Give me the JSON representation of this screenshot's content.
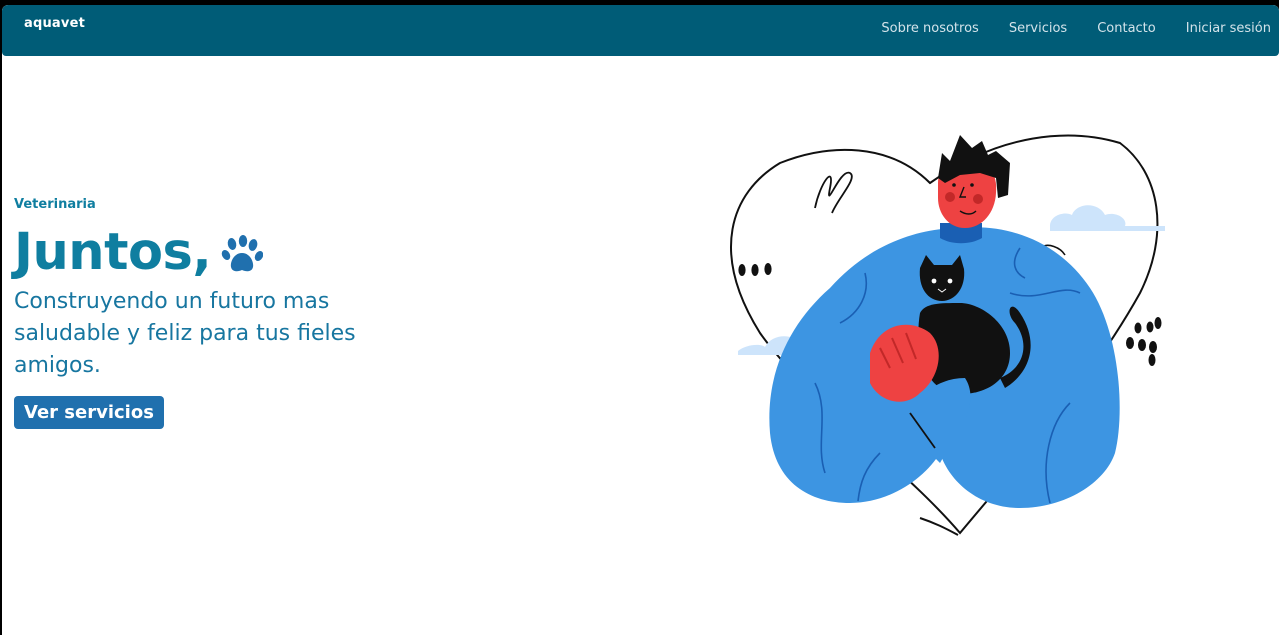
{
  "navbar": {
    "brand": "aquavet",
    "links": [
      "Sobre nosotros",
      "Servicios",
      "Contacto",
      "Iniciar sesión"
    ]
  },
  "hero": {
    "eyebrow": "Veterinaria",
    "headline": "Juntos,",
    "subtitle": "Construyendo un futuro mas saludable y feliz para tus fieles amigos.",
    "cta_label": "Ver servicios"
  },
  "icons": {
    "headline_icon": "paw-icon"
  },
  "colors": {
    "navbar_bg": "#005c77",
    "primary_text": "#0f7ea0",
    "button_bg": "#2070ae",
    "illustration_blue": "#3d95e2",
    "illustration_red": "#ee4242"
  }
}
